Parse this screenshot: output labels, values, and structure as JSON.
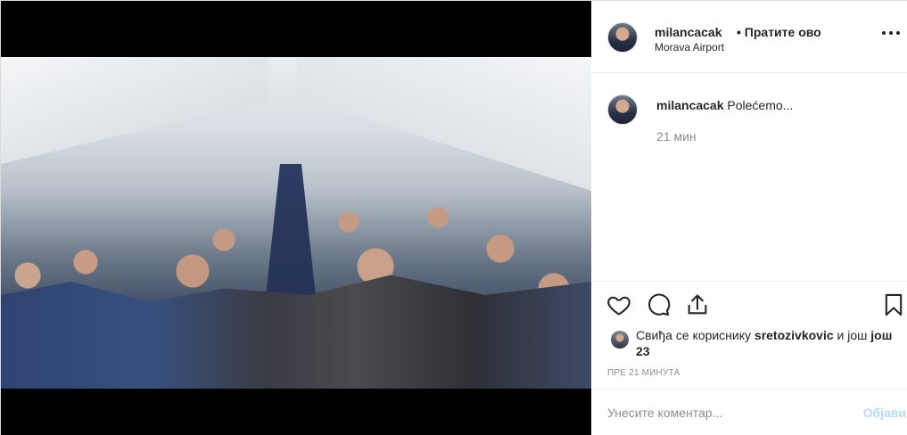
{
  "post": {
    "username": "milancacak",
    "separator": "•",
    "follow_label": "Пратите ово",
    "location": "Morava Airport",
    "more_icon": "more-horizontal-icon"
  },
  "caption": {
    "username": "milancacak",
    "text": "Polećemo...",
    "time": "21 мин"
  },
  "actions": {
    "like_icon": "heart-icon",
    "comment_icon": "comment-icon",
    "share_icon": "share-icon",
    "save_icon": "bookmark-icon"
  },
  "likes": {
    "prefix": "Свиђа се кориснику",
    "user": "sretozivkovic",
    "suffix": "и још",
    "others": "још 23"
  },
  "timestamp": "ПРЕ 21 МИНУТА",
  "comment_box": {
    "placeholder": "Унесите коментар...",
    "post_label": "Објави"
  },
  "colors": {
    "text": "#262626",
    "muted": "#8e8e8e",
    "post_disabled": "#b3dbff",
    "border": "#efefef"
  }
}
